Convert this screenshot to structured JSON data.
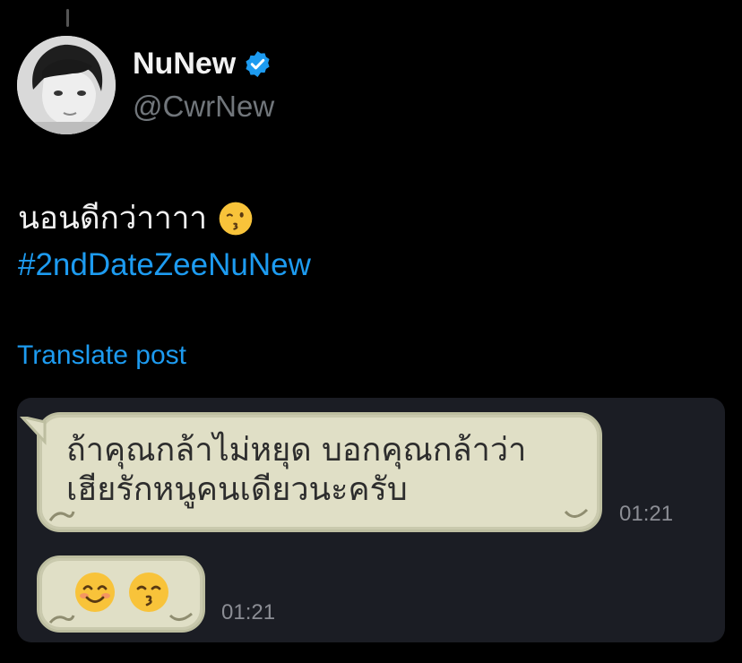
{
  "user": {
    "display_name": "NuNew",
    "handle": "@CwrNew",
    "verified_icon": "verified-badge-icon"
  },
  "tweet": {
    "text": "นอนดีกว่าาาา",
    "text_emoji": "kissing-face-emoji",
    "hashtag": "#2ndDateZeeNuNew",
    "translate_label": "Translate post"
  },
  "chat": {
    "message1": {
      "line1": "ถ้าคุณกล้าไม่หยุด บอกคุณกล้าว่า",
      "line2": "เฮียรักหนูคนเดียวนะครับ",
      "time": "01:21"
    },
    "message2": {
      "emojis": [
        "smiling-face-emoji",
        "kissing-face-emoji"
      ],
      "time": "01:21"
    }
  },
  "colors": {
    "background": "#000000",
    "accent": "#1d9bf0",
    "handle": "#71767b",
    "bubble": "#e0dfc6",
    "chat_bg": "#1b1d24"
  }
}
